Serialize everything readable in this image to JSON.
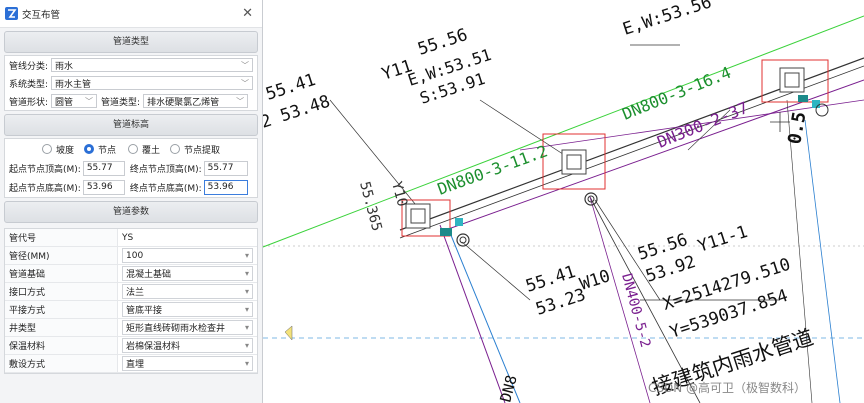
{
  "window": {
    "title": "交互布管"
  },
  "sections": {
    "pipe_type": "管道类型",
    "pipe_elevation": "管道标高",
    "pipe_params": "管道参数"
  },
  "pipe_type": {
    "line_category_label": "管线分类:",
    "line_category_value": "雨水",
    "system_type_label": "系统类型:",
    "system_type_value": "雨水主管",
    "pipe_shape_label": "管道形状:",
    "pipe_shape_value": "圆管",
    "pipe_kind_label": "管道类型:",
    "pipe_kind_value": "排水硬聚氯乙烯管"
  },
  "elevation": {
    "modes": [
      "坡度",
      "节点",
      "覆土",
      "节点提取"
    ],
    "selected_mode": "节点",
    "start_top_label": "起点节点顶高(M):",
    "start_top_value": "55.77",
    "end_top_label": "终点节点顶高(M):",
    "end_top_value": "55.77",
    "start_bottom_label": "起点节点底高(M):",
    "start_bottom_value": "53.96",
    "end_bottom_label": "终点节点底高(M):",
    "end_bottom_value": "53.96"
  },
  "params": {
    "rows": [
      {
        "key": "管代号",
        "value": "YS",
        "dropdown": false
      },
      {
        "key": "管径(MM)",
        "value": "100",
        "dropdown": true
      },
      {
        "key": "管道基础",
        "value": "混凝土基础",
        "dropdown": true
      },
      {
        "key": "接口方式",
        "value": "法兰",
        "dropdown": true
      },
      {
        "key": "平接方式",
        "value": "管底平接",
        "dropdown": true
      },
      {
        "key": "井类型",
        "value": "矩形直线砖砌雨水检查井",
        "dropdown": true
      },
      {
        "key": "保温材料",
        "value": "岩棉保温材料",
        "dropdown": true
      },
      {
        "key": "敷设方式",
        "value": "直埋",
        "dropdown": true
      }
    ]
  },
  "cad": {
    "texts": {
      "t1": "55.41",
      "t2": "2 53.48",
      "t3": "55.56",
      "t4": "Y11",
      "t5": "E,W:53.51",
      "t6": "S:53.91",
      "t7": "DN800-3-11.2",
      "t8": "DN800-3-16.4",
      "t9": "DN300-2-37",
      "t10": "0.5",
      "t11": "E,W:53.56",
      "t12": "55.56",
      "t13": "53.92",
      "t14": "Y11-1",
      "t15": "55.41",
      "t16": "53.23",
      "t17": "W10",
      "t18": "X=2514279.510",
      "t19": "Y=539037.854",
      "t20": "接建筑内雨水管道",
      "t21": "DN8",
      "t22": "CSDN @高可卫（极智数科）",
      "t23": "55.365",
      "t24": "Y10",
      "t25": "DN400-5-2"
    }
  },
  "colors": {
    "accent": "#2b6fd6",
    "red_box": "#e03030",
    "green_pipe": "#1c8f2e",
    "purple_pipe": "#7a1f8f"
  }
}
